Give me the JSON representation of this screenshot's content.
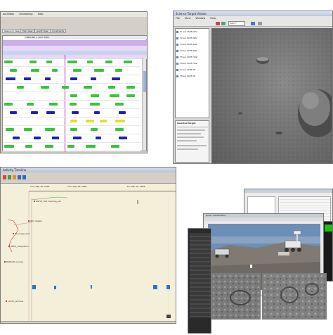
{
  "planner": {
    "menu": [
      "Activities",
      "Scheduling",
      "Help"
    ],
    "tabs": [
      "Resource View",
      "Plan View",
      "Gantt View",
      "Constraints"
    ],
    "lane_header": "TIMELINE 1  |  ACT 3801",
    "colors": {
      "header": "#c9b0e6",
      "band1": "#ead6f5",
      "band2": "#c6d6f0",
      "green": "#34c934",
      "blue": "#2020b8",
      "yellow": "#e8e020",
      "magenta": "#c020c0"
    }
  },
  "viewer": {
    "title": "Science Target Viewer",
    "menu": [
      "File",
      "View",
      "Window",
      "Help"
    ],
    "toolbar_field": "Cam 7",
    "side_panel_title": "Selected Target",
    "list_items": [
      "T1 sol 2005 NAV",
      "T2 sol 2005 NAV",
      "T3 sol 2005 PAN",
      "T4 sol 2005 PAN",
      "T5 sol 2005 HAZ",
      "T6 sol 2005 HAZ",
      "T7 sol 2005 MI",
      "T8 sol 2005 MI"
    ]
  },
  "timeline": {
    "title": "Activity Timeline",
    "time_labels": [
      "Thu, Sep 18, 2004",
      "Thu, Sep 18, 2004",
      "Fri, Sep 19, 2004"
    ],
    "events": [
      "DRIVE_001 heading_set",
      "IDD_deploy",
      "MI_image_seq",
      "APXS_integration",
      "PANCAM_survey",
      "comm_window"
    ]
  },
  "composite": {
    "title": "Rover Visualization"
  }
}
